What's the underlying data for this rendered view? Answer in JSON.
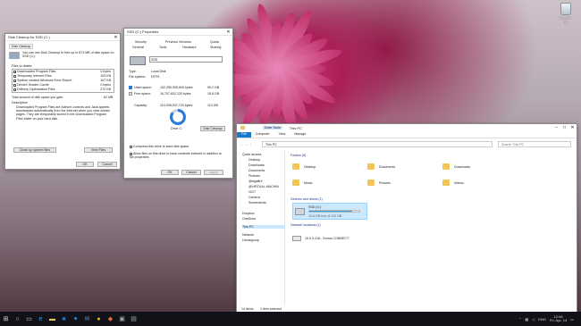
{
  "desktop": {
    "icon_label": "Recycle Bin"
  },
  "cleanup": {
    "title": "Disk Cleanup for SSD (C:)",
    "tab": "Disk Cleanup",
    "intro": "You can use Disk Cleanup to free up to 873 MB of disk space on SSD (C:).",
    "files_label": "Files to delete:",
    "files": [
      {
        "name": "Downloaded Program Files",
        "size": "0 bytes",
        "checked": true
      },
      {
        "name": "Temporary Internet Files",
        "size": "153 KB",
        "checked": true
      },
      {
        "name": "System created Windows Error Report",
        "size": "167 KB",
        "checked": true
      },
      {
        "name": "DirectX Shader Cache",
        "size": "0 bytes",
        "checked": false
      },
      {
        "name": "Delivery Optimization Files",
        "size": "272 KB",
        "checked": false
      }
    ],
    "total_label": "Total amount of disk space you gain:",
    "total_value": "62 MB",
    "desc_label": "Description",
    "description": "Downloaded Program Files are ActiveX controls and Java applets downloaded automatically from the Internet when you view certain pages. They are temporarily stored in the Downloaded Program Files folder on your hard disk.",
    "clean_system": "Clean up system files",
    "view_files": "View Files",
    "ok": "OK",
    "cancel": "Cancel"
  },
  "props": {
    "title": "SSD (C:) Properties",
    "tabs_row1": [
      "Security",
      "Previous Versions",
      "Quota"
    ],
    "tabs_row2": [
      "General",
      "Tools",
      "Hardware",
      "Sharing"
    ],
    "name": "SSD",
    "type_label": "Type:",
    "type_value": "Local Disk",
    "fs_label": "File system:",
    "fs_value": "NTFS",
    "used_label": "Used space:",
    "used_bytes": "102,250,905,600 bytes",
    "used_gb": "95.2 GB",
    "free_label": "Free space:",
    "free_bytes": "16,757,632,120 bytes",
    "free_gb": "15.6 GB",
    "cap_label": "Capacity:",
    "cap_bytes": "119,008,537,720 bytes",
    "cap_gb": "110 GB",
    "drive_label": "Drive C:",
    "cleanup_btn": "Disk Cleanup",
    "compress": "Compress this drive to save disk space",
    "index": "Allow files on this drive to have contents indexed in addition to file properties",
    "ok": "OK",
    "cancel": "Cancel",
    "apply": "Apply",
    "used_fraction": 0.86
  },
  "explorer": {
    "title": "This PC",
    "ribbon_tab": "Drive Tools",
    "ribbon_tabs": [
      "File",
      "Computer",
      "View",
      "Manage"
    ],
    "address": "This PC",
    "search": "Search This PC",
    "nav": [
      "Quick access",
      "Desktop",
      "Downloads",
      "Documents",
      "Pictures",
      "@bigaffre",
      "@VIRTUAL MACHIN",
      "2017",
      "Camera",
      "Screenshots",
      "Dropbox",
      "OneDrive",
      "This PC",
      "Network",
      "Homegroup"
    ],
    "folders_header": "Folders (6)",
    "folders": [
      "Desktop",
      "Documents",
      "Downloads",
      "Music",
      "Pictures",
      "Videos"
    ],
    "drives_header": "Devices and drives (1)",
    "drive_name": "SSD (C:)",
    "drive_free": "15.6 GB free of 110 GB",
    "drive_fraction": 0.86,
    "net_header": "Network locations (1)",
    "net_item": "10.0.0.218 - Sonos CONNECT",
    "status": "14 items",
    "status_sel": "1 item selected"
  },
  "taskbar": {
    "time": "12:06",
    "date": "Fri, Apr. 14",
    "lang": "ENG"
  }
}
